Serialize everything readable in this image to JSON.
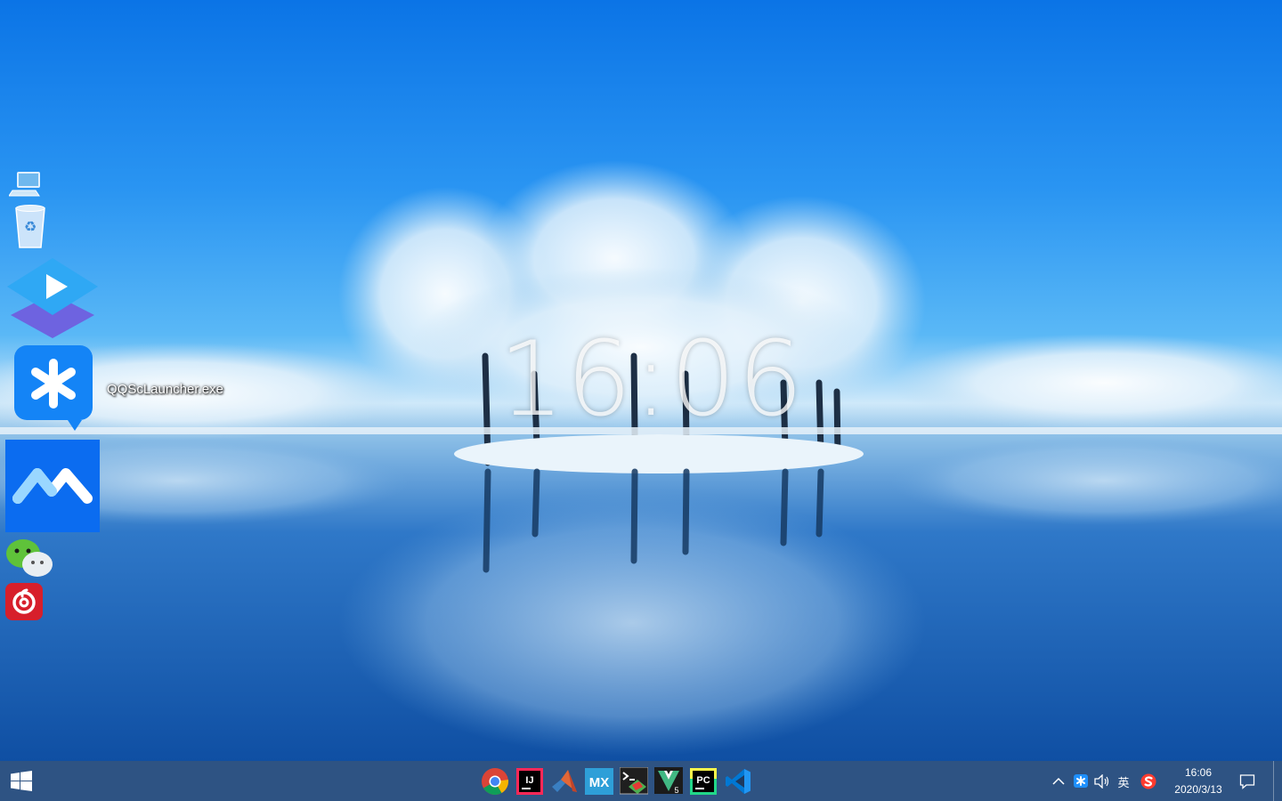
{
  "clock": {
    "time": "16:06"
  },
  "desktop": {
    "icons": [
      {
        "name": "this-pc",
        "icon": "computer-icon"
      },
      {
        "name": "recycle-bin",
        "icon": "recycle-bin-icon"
      },
      {
        "name": "video-player",
        "icon": "play-icon"
      },
      {
        "name": "qqsc-launcher",
        "icon": "asterisk-icon",
        "label": "QQScLauncher.exe"
      },
      {
        "name": "tencent-meeting",
        "icon": "meeting-icon"
      },
      {
        "name": "wechat",
        "icon": "wechat-icon"
      },
      {
        "name": "netease-music",
        "icon": "music-icon"
      }
    ]
  },
  "taskbar": {
    "start_icon": "windows-logo-icon",
    "pinned": [
      {
        "name": "chrome",
        "icon": "chrome-icon"
      },
      {
        "name": "intellij",
        "icon": "intellij-icon",
        "text": "IJ"
      },
      {
        "name": "matlab",
        "icon": "matlab-icon"
      },
      {
        "name": "mobaxterm",
        "icon": "mobaxterm-icon",
        "text": "MX"
      },
      {
        "name": "terminal-app",
        "icon": "terminal-icon"
      },
      {
        "name": "vue-app",
        "icon": "vue-icon",
        "text": "5"
      },
      {
        "name": "pycharm",
        "icon": "pycharm-icon",
        "text": "PC"
      },
      {
        "name": "vscode",
        "icon": "vscode-icon"
      }
    ],
    "tray": {
      "ime_label": "英",
      "time": "16:06",
      "date": "2020/3/13"
    }
  },
  "colors": {
    "taskbar": "#1c4478",
    "accent": "#1e90ff"
  }
}
